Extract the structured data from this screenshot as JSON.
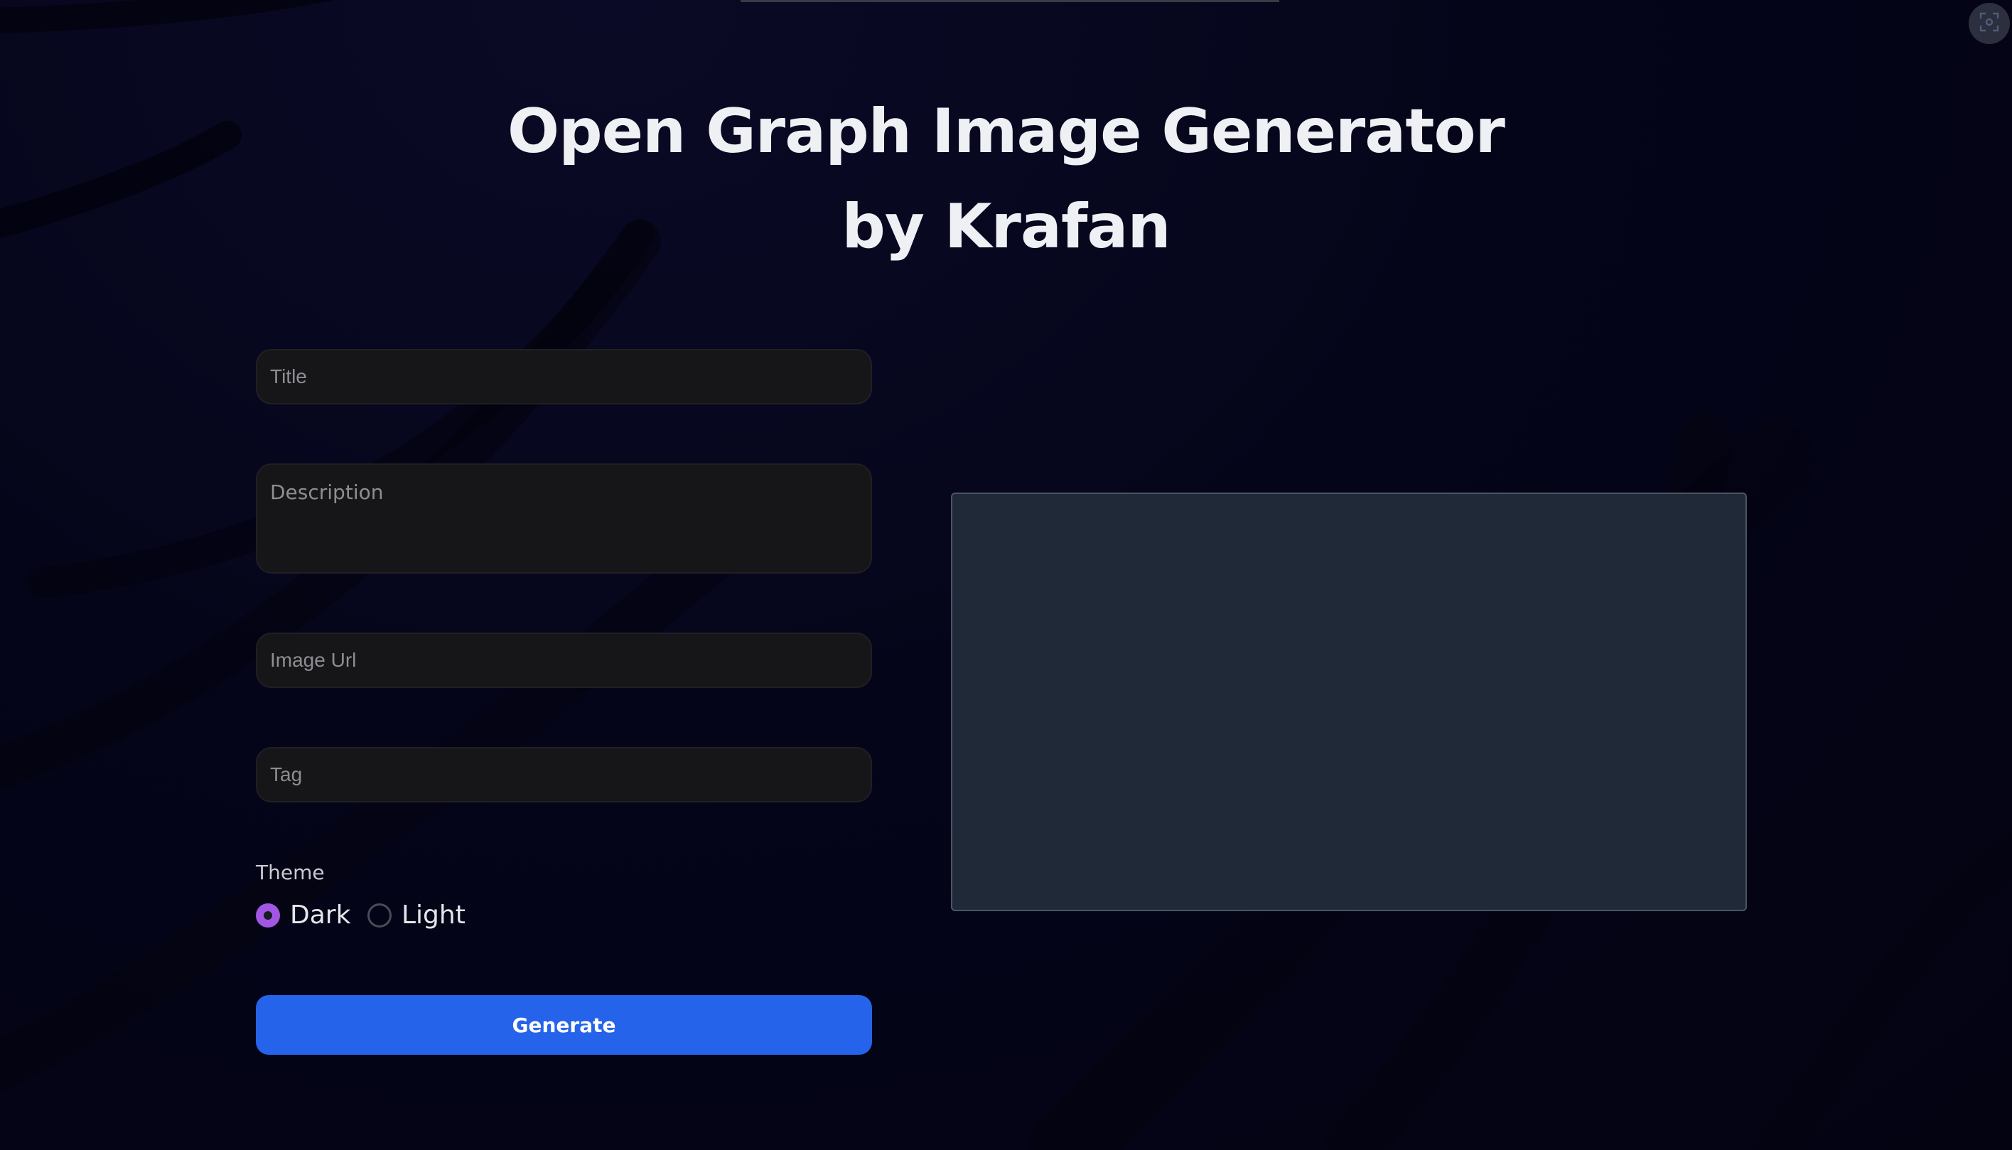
{
  "header": {
    "title_line1": "Open Graph Image Generator",
    "title_line2": "by Krafan"
  },
  "form": {
    "title_placeholder": "Title",
    "description_placeholder": "Description",
    "image_url_placeholder": "Image Url",
    "tag_placeholder": "Tag",
    "theme_label": "Theme",
    "theme_options": [
      "Dark",
      "Light"
    ],
    "theme_selected": "Dark",
    "generate_label": "Generate"
  },
  "colors": {
    "background": "#05051a",
    "accent_button": "#2563eb",
    "radio_selected": "#a257e4",
    "preview_panel": "#1f2937"
  },
  "icons": {
    "corner_button": "screenshot-capture-icon"
  }
}
